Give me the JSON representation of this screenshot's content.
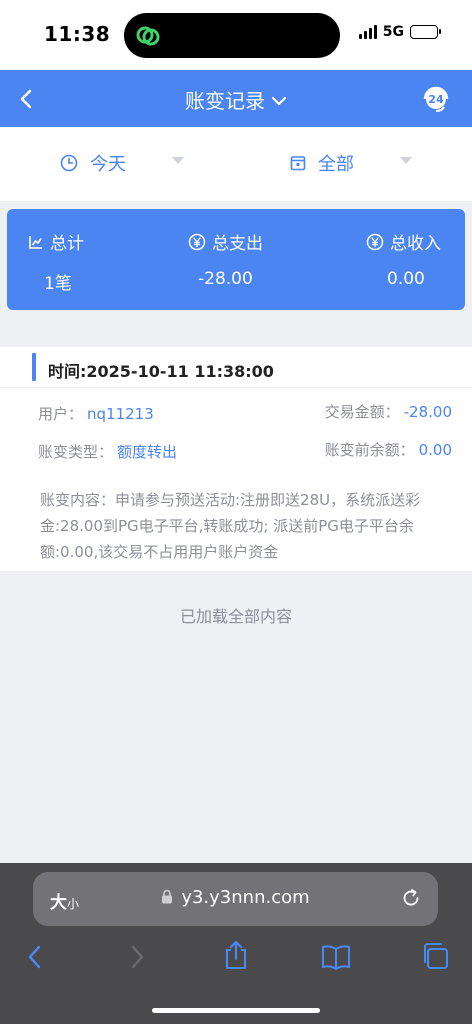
{
  "status_bar": {
    "time": "11:38",
    "network": "5G"
  },
  "nav": {
    "title": "账变记录",
    "support_badge": "24"
  },
  "filters": {
    "date_label": "今天",
    "type_label": "全部"
  },
  "summary": {
    "total_label": "总计",
    "total_value": "1笔",
    "expense_label": "总支出",
    "expense_value": "-28.00",
    "income_label": "总收入",
    "income_value": "0.00"
  },
  "record": {
    "time": "时间:2025-10-11 11:38:00",
    "user_label": "用户：",
    "user_value": "nq11213",
    "amount_label": "交易金额：",
    "amount_value": "-28.00",
    "type_label": "账变类型：",
    "type_value": "额度转出",
    "balance_label": "账变前余额：",
    "balance_value": "0.00",
    "content": "账变内容：申请参与预送活动:注册即送28U，系统派送彩金:28.00到PG电子平台,转账成功; 派送前PG电子平台余额:0.00,该交易不占用用户账户资金"
  },
  "loaded_text": "已加载全部内容",
  "browser": {
    "text_size_big": "大",
    "text_size_small": "小",
    "url": "y3.y3nnn.com"
  },
  "colors": {
    "accent": "#4a85f1",
    "muted_text": "#8c9099",
    "page_bg": "#eef0f4"
  }
}
